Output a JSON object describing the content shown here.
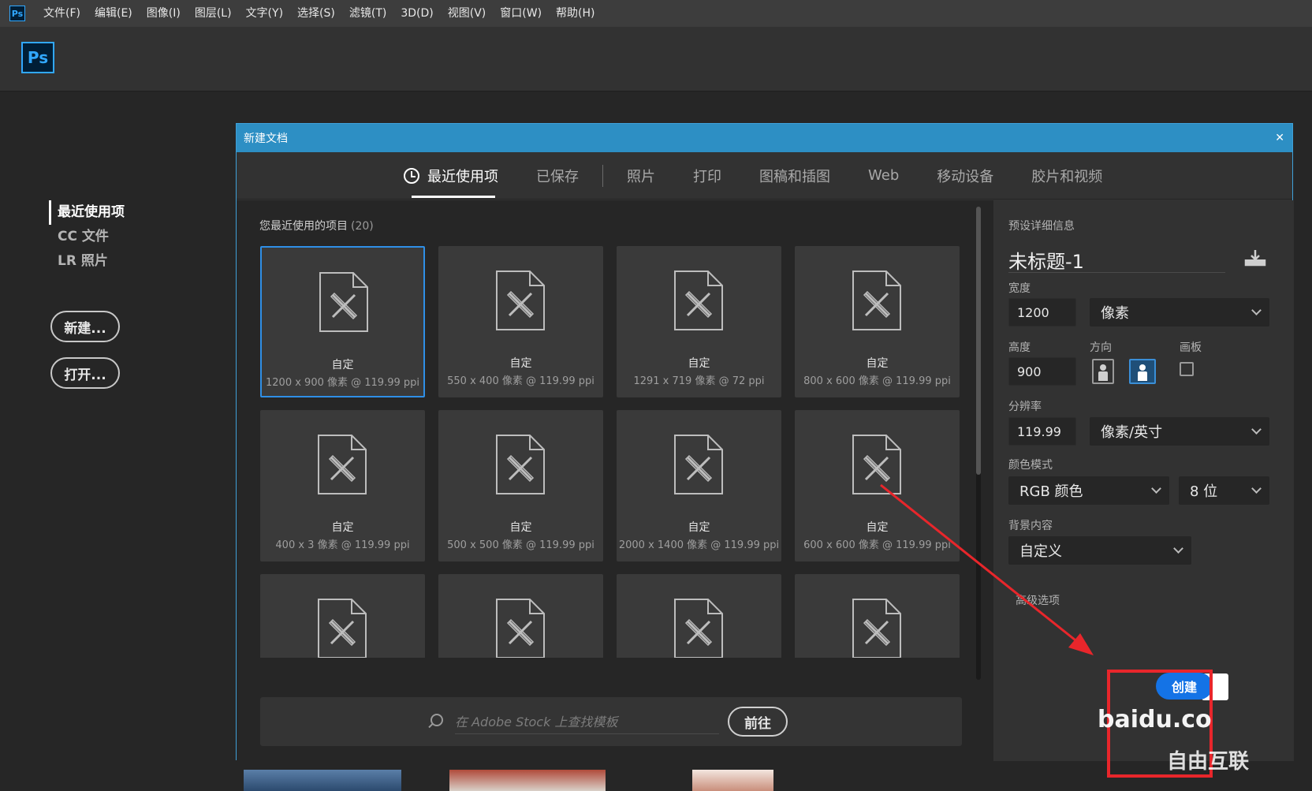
{
  "menubar": {
    "app_icon": "Ps",
    "items": [
      "文件(F)",
      "编辑(E)",
      "图像(I)",
      "图层(L)",
      "文字(Y)",
      "选择(S)",
      "滤镜(T)",
      "3D(D)",
      "视图(V)",
      "窗口(W)",
      "帮助(H)"
    ]
  },
  "header": {
    "logo": "Ps"
  },
  "leftnav": {
    "items": [
      "最近使用项",
      "CC 文件",
      "LR 照片"
    ],
    "new_label": "新建...",
    "open_label": "打开..."
  },
  "dialog": {
    "title": "新建文档",
    "tabs": [
      "最近使用项",
      "已保存",
      "照片",
      "打印",
      "图稿和插图",
      "Web",
      "移动设备",
      "胶片和视频"
    ],
    "recent_title": "您最近使用的项目",
    "recent_count": "(20)",
    "presets": [
      {
        "name": "自定",
        "size": "1200 x 900 像素 @ 119.99 ppi"
      },
      {
        "name": "自定",
        "size": "550 x 400 像素 @ 119.99 ppi"
      },
      {
        "name": "自定",
        "size": "1291 x 719 像素 @ 72 ppi"
      },
      {
        "name": "自定",
        "size": "800 x 600 像素 @ 119.99 ppi"
      },
      {
        "name": "自定",
        "size": "400 x 3 像素 @ 119.99 ppi"
      },
      {
        "name": "自定",
        "size": "500 x 500 像素 @ 119.99 ppi"
      },
      {
        "name": "自定",
        "size": "2000 x 1400 像素 @ 119.99 ppi"
      },
      {
        "name": "自定",
        "size": "600 x 600 像素 @ 119.99 ppi"
      },
      {
        "name": "",
        "size": ""
      },
      {
        "name": "",
        "size": ""
      },
      {
        "name": "",
        "size": ""
      },
      {
        "name": "",
        "size": ""
      }
    ],
    "search_placeholder": "在 Adobe Stock 上查找模板",
    "go_label": "前往"
  },
  "panel": {
    "section_label": "预设详细信息",
    "doc_title": "未标题-1",
    "width_label": "宽度",
    "width_value": "1200",
    "width_unit": "像素",
    "height_label": "高度",
    "height_value": "900",
    "orientation_label": "方向",
    "artboard_label": "画板",
    "resolution_label": "分辨率",
    "resolution_value": "119.99",
    "resolution_unit": "像素/英寸",
    "color_mode_label": "颜色模式",
    "color_mode_value": "RGB 颜色",
    "bit_depth_value": "8 位",
    "background_label": "背景内容",
    "background_value": "自定义",
    "advanced_label": "高级选项",
    "create_label": "创建"
  },
  "colors": {
    "accent": "#1473e6",
    "title_bar": "#2d8fc4",
    "annotation_red": "#e8262b"
  },
  "watermark": {
    "text1": "baidu.co",
    "text2": "自由互联"
  }
}
